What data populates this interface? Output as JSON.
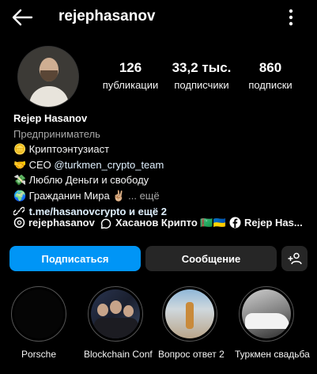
{
  "header": {
    "username": "rejephasanov",
    "back_icon": "arrow-left-icon",
    "more_icon": "vertical-dots-icon"
  },
  "stats": {
    "posts_value": "126",
    "posts_label": "публикации",
    "followers_value": "33,2 тыс.",
    "followers_label": "подписчики",
    "following_value": "860",
    "following_label": "подписки"
  },
  "bio": {
    "name": "Rejep Hasanov",
    "category": "Предприниматель",
    "line1_emoji": "🪙",
    "line1_text": "Криптоэнтузиаст",
    "line2_emoji": "🤝",
    "line2_text": "CEO ",
    "line2_mention": "@turkmen_crypto_team",
    "line3_emoji": "💸",
    "line3_text": "Люблю Деньги и свободу",
    "line4_emoji": "🌍",
    "line4_text": "Гражданин Мира ✌🏼",
    "line4_more": "... ещё",
    "link_text": "t.me/hasanovcrypto и ещё 2"
  },
  "chips": {
    "threads_label": "rejephasanov",
    "channel_label": "Хасанов Крипто 🇹🇲🇺🇦",
    "facebook_label": "Rejep Has..."
  },
  "actions": {
    "follow_label": "Подписаться",
    "message_label": "Сообщение",
    "add_icon": "add-person-icon"
  },
  "highlights": [
    {
      "label": "Porsche"
    },
    {
      "label": "Blockchain Conf"
    },
    {
      "label": "Вопрос ответ 2"
    },
    {
      "label": "Туркмен свадьба"
    }
  ],
  "colors": {
    "accent": "#0095f6",
    "background": "#000000",
    "secondary_button": "#262626",
    "link": "#e0f1ff"
  }
}
